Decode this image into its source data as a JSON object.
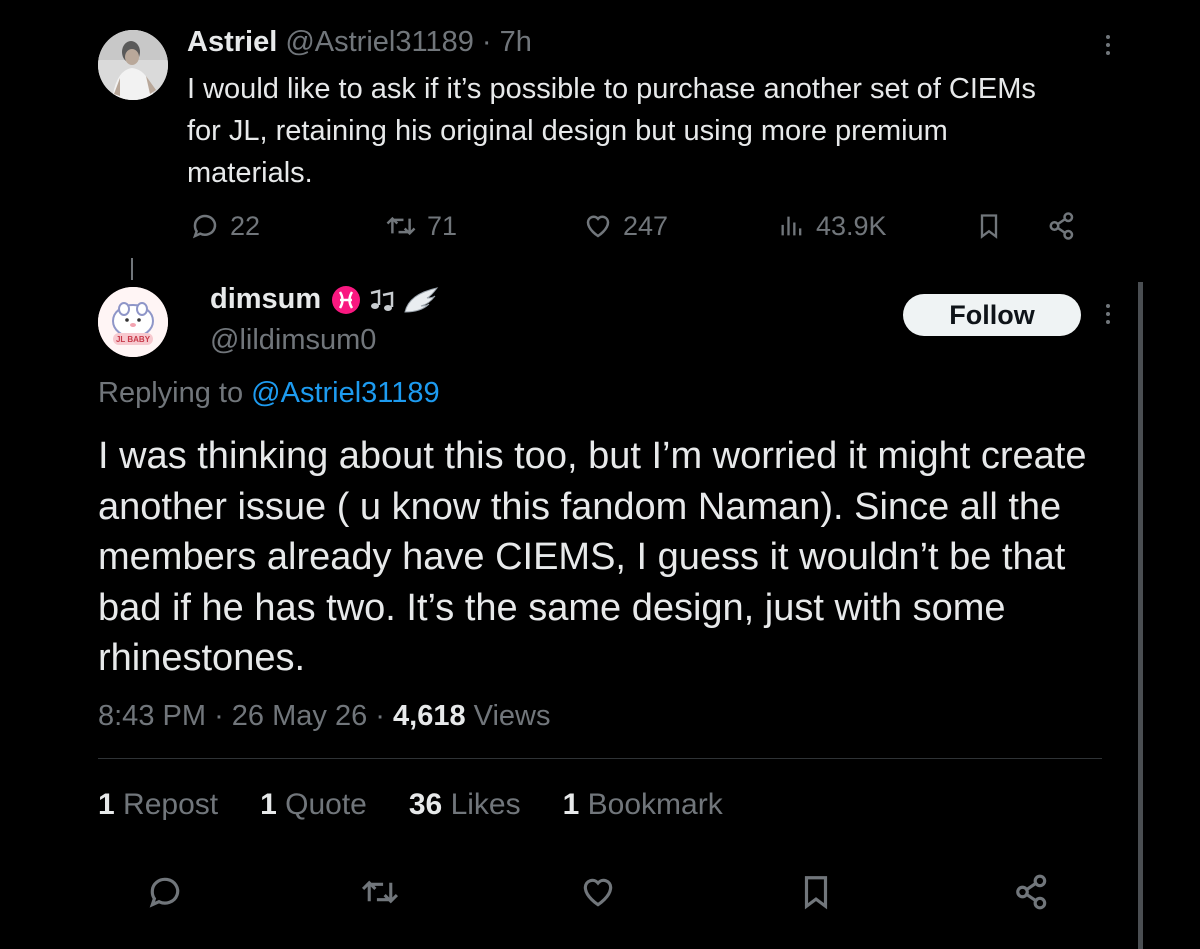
{
  "parent_tweet": {
    "author_name": "Astriel",
    "author_handle": "@Astriel31189",
    "separator": "·",
    "time": "7h",
    "text": "I would like to ask if it’s possible to purchase another set of CIEMs for JL, retaining his original design but using more premium materials.",
    "actions": {
      "replies": "22",
      "reposts": "71",
      "likes": "247",
      "views": "43.9K"
    },
    "icons": [
      "reply-icon",
      "repost-icon",
      "like-icon",
      "views-icon",
      "bookmark-icon",
      "share-icon",
      "more-icon"
    ]
  },
  "main_tweet": {
    "author_name": "dimsum",
    "author_handle": "@lildimsum0",
    "name_emoji": [
      "pisces-icon",
      "music-notes-icon",
      "wing-icon"
    ],
    "follow_label": "Follow",
    "replying_prefix": "Replying to",
    "replying_to": "@Astriel31189",
    "text": "I was thinking about this too, but I’m worried it might create another issue ( u know this fandom Naman). Since all the members already have CIEMS, I guess it wouldn’t be that bad if he has two. It’s the same design, just with some rhinestones.",
    "time": "8:43 PM",
    "date": "26 May 26",
    "sep": "·",
    "views_count": "4,618",
    "views_label": "Views",
    "stats": [
      {
        "count": "1",
        "label": "Repost"
      },
      {
        "count": "1",
        "label": "Quote"
      },
      {
        "count": "36",
        "label": "Likes"
      },
      {
        "count": "1",
        "label": "Bookmark"
      }
    ]
  },
  "avatar_badge_text": "JL BABY",
  "colors": {
    "background": "#000000",
    "text": "#e7e9ea",
    "muted": "#71767b",
    "link": "#1d9bf0",
    "divider": "#2f3336",
    "follow_bg": "#eff3f4",
    "pisces": "#f91880"
  }
}
